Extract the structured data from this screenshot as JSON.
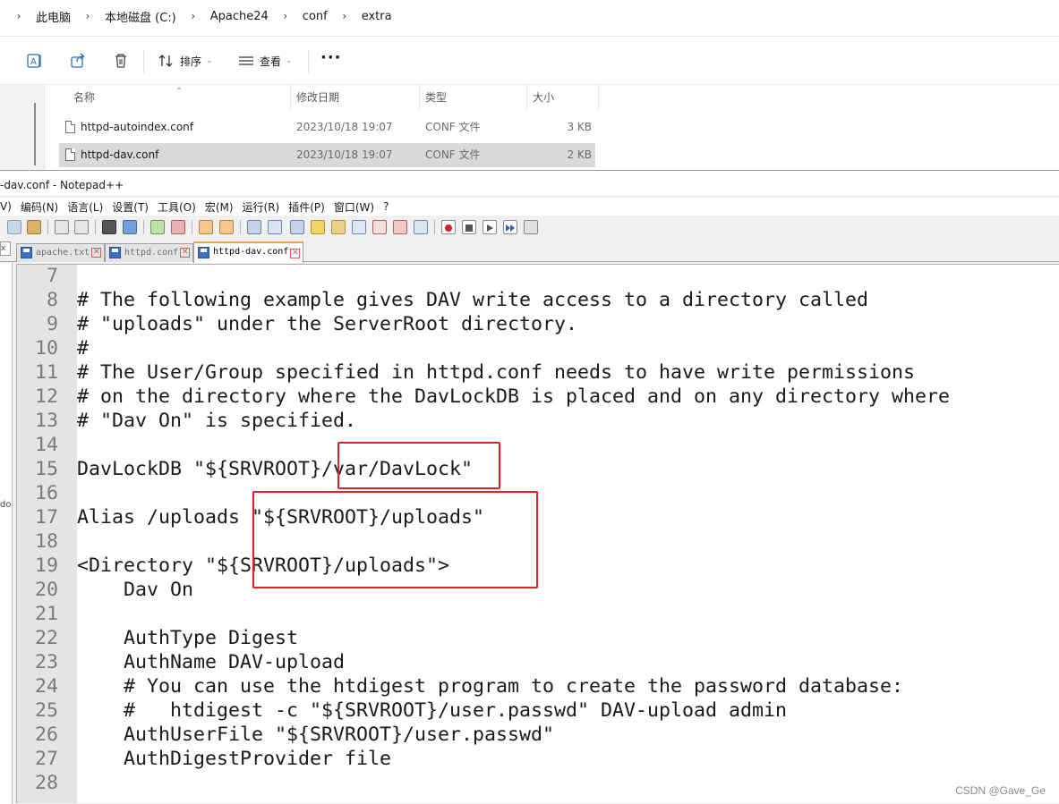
{
  "explorer": {
    "breadcrumb": [
      "此电脑",
      "本地磁盘 (C:)",
      "Apache24",
      "conf",
      "extra"
    ],
    "commands": {
      "sort_label": "排序",
      "view_label": "查看",
      "more_label": "···"
    },
    "columns": {
      "name": "名称",
      "date": "修改日期",
      "type": "类型",
      "size": "大小"
    },
    "files": [
      {
        "name": "httpd-autoindex.conf",
        "date": "2023/10/18 19:07",
        "type": "CONF 文件",
        "size": "3 KB"
      },
      {
        "name": "httpd-dav.conf",
        "date": "2023/10/18 19:07",
        "type": "CONF 文件",
        "size": "2 KB",
        "selected": true
      }
    ]
  },
  "notepad": {
    "title": "-dav.conf - Notepad++",
    "menu": [
      "V)",
      "编码(N)",
      "语言(L)",
      "设置(T)",
      "工具(O)",
      "宏(M)",
      "运行(R)",
      "插件(P)",
      "窗口(W)",
      "?"
    ],
    "side_tab": "x",
    "tabs": [
      {
        "label": "apache.txt",
        "active": false
      },
      {
        "label": "httpd.conf",
        "active": false
      },
      {
        "label": "httpd-dav.conf",
        "active": true
      }
    ],
    "dock_label": "do",
    "lines": [
      {
        "n": "7",
        "text": ""
      },
      {
        "n": "8",
        "text": "# The following example gives DAV write access to a directory called"
      },
      {
        "n": "9",
        "text": "# \"uploads\" under the ServerRoot directory."
      },
      {
        "n": "10",
        "text": "#"
      },
      {
        "n": "11",
        "text": "# The User/Group specified in httpd.conf needs to have write permissions"
      },
      {
        "n": "12",
        "text": "# on the directory where the DavLockDB is placed and on any directory where"
      },
      {
        "n": "13",
        "text": "# \"Dav On\" is specified."
      },
      {
        "n": "14",
        "text": ""
      },
      {
        "n": "15",
        "text": "DavLockDB \"${SRVROOT}/var/DavLock\""
      },
      {
        "n": "16",
        "text": ""
      },
      {
        "n": "17",
        "text": "Alias /uploads \"${SRVROOT}/uploads\""
      },
      {
        "n": "18",
        "text": ""
      },
      {
        "n": "19",
        "text": "<Directory \"${SRVROOT}/uploads\">"
      },
      {
        "n": "20",
        "text": "    Dav On"
      },
      {
        "n": "21",
        "text": ""
      },
      {
        "n": "22",
        "text": "    AuthType Digest"
      },
      {
        "n": "23",
        "text": "    AuthName DAV-upload"
      },
      {
        "n": "24",
        "text": "    # You can use the htdigest program to create the password database:"
      },
      {
        "n": "25",
        "text": "    #   htdigest -c \"${SRVROOT}/user.passwd\" DAV-upload admin"
      },
      {
        "n": "26",
        "text": "    AuthUserFile \"${SRVROOT}/user.passwd\""
      },
      {
        "n": "27",
        "text": "    AuthDigestProvider file"
      },
      {
        "n": "28",
        "text": ""
      }
    ]
  },
  "annotation_color": "#e0202a",
  "watermark": "CSDN @Gave_Ge"
}
